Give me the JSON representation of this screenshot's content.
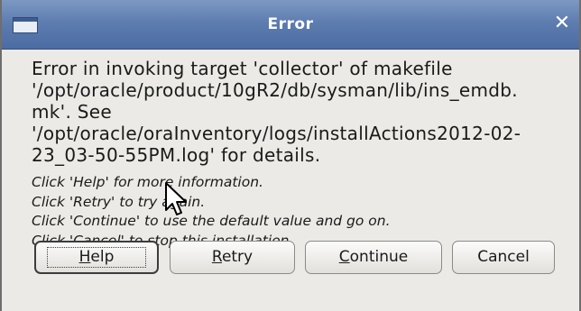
{
  "window": {
    "title": "Error",
    "close_icon": "close-icon",
    "app_icon": "window-icon"
  },
  "message": {
    "text": "Error in invoking target 'collector' of makefile\n'/opt/oracle/product/10gR2/db/sysman/lib/ins_emdb.\nmk'. See\n'/opt/oracle/oraInventory/logs/installActions2012-02-\n23_03-50-55PM.log' for details."
  },
  "hints": [
    "Click 'Help' for more information.",
    "Click 'Retry' to try again.",
    "Click 'Continue' to use the default value and go on.",
    "Click 'Cancel' to stop this installation."
  ],
  "buttons": {
    "help": {
      "label": "Help",
      "mnemonic": "H"
    },
    "retry": {
      "label": "Retry",
      "mnemonic": "R"
    },
    "continue": {
      "label": "Continue",
      "mnemonic": "C"
    },
    "cancel": {
      "label": "Cancel"
    }
  },
  "colors": {
    "titlebar": "#5e7db0",
    "dialog_bg": "#eceae6"
  }
}
